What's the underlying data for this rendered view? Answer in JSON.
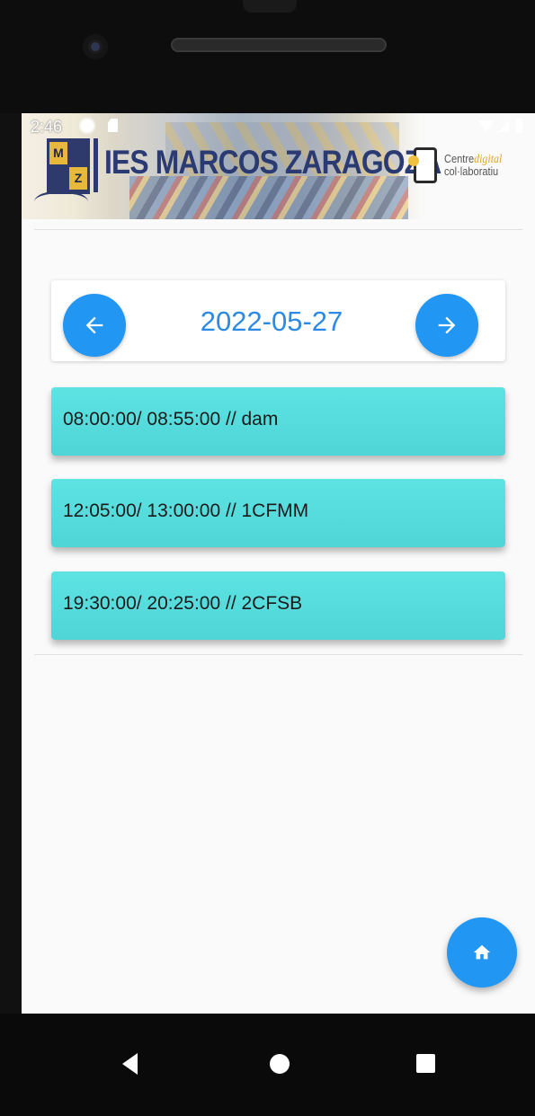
{
  "status_bar": {
    "time": "2:46",
    "icons": [
      "settings-icon",
      "sd-card-icon",
      "wifi-icon",
      "signal-icon",
      "battery-icon"
    ]
  },
  "header": {
    "logo_letters": [
      "M",
      "",
      "",
      "Z"
    ],
    "school_name": "IES MARCOS ZARAGOZA",
    "partner_prefix": "Centre",
    "partner_highlight": "digital",
    "partner_suffix": "col·laboratiu"
  },
  "date_nav": {
    "prev_icon": "arrow-left-icon",
    "next_icon": "arrow-right-icon",
    "date": "2022-05-27"
  },
  "slots": [
    {
      "text": "08:00:00/ 08:55:00 // dam"
    },
    {
      "text": "12:05:00/ 13:00:00 // 1CFMM"
    },
    {
      "text": "19:30:00/ 20:25:00 // 2CFSB"
    }
  ],
  "fab": {
    "icon": "home-icon"
  },
  "colors": {
    "accent": "#2196f3",
    "slot": "#55dcdc",
    "date_text": "#2a8ae6",
    "school_name": "#2a3a72"
  },
  "android_nav": [
    "back-icon",
    "home-circle-icon",
    "recents-icon"
  ]
}
